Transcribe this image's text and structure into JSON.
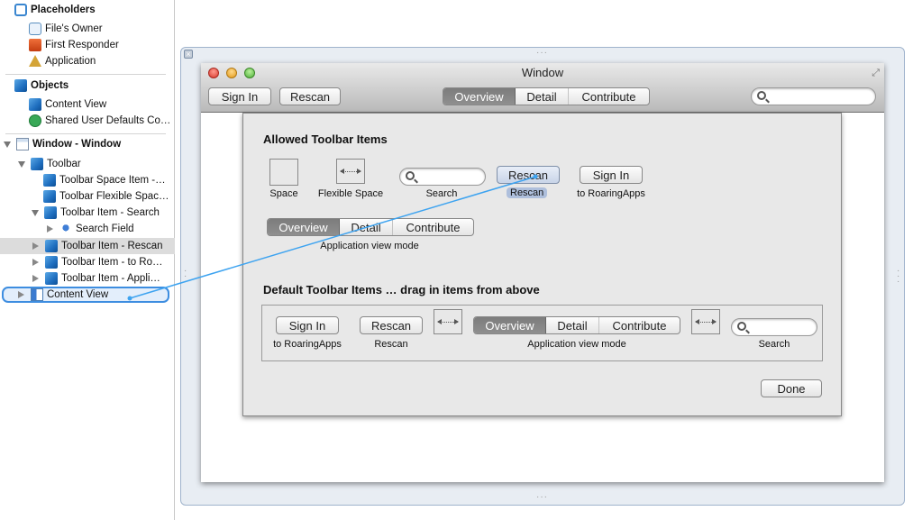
{
  "outline": {
    "placeholders": {
      "label": "Placeholders",
      "items": [
        {
          "label": "File's Owner",
          "icon": "files-owner-icon"
        },
        {
          "label": "First Responder",
          "icon": "first-responder-icon"
        },
        {
          "label": "Application",
          "icon": "application-icon"
        }
      ]
    },
    "objects": {
      "label": "Objects",
      "items": [
        {
          "label": "Content View",
          "icon": "view-cube-icon"
        },
        {
          "label": "Shared User Defaults Co…",
          "icon": "user-defaults-icon"
        }
      ]
    },
    "window": {
      "label": "Window - Window",
      "toolbar": "Toolbar",
      "toolbar_items": [
        "Toolbar Space Item -…",
        "Toolbar Flexible Spac…",
        "Toolbar Item - Search",
        "Search Field",
        "Toolbar Item - Rescan",
        "Toolbar Item - to Ro…",
        "Toolbar Item - Appli…"
      ],
      "content_view": "Content View",
      "selected": "Toolbar Item - Rescan"
    }
  },
  "window": {
    "title": "Window",
    "toolbar": {
      "sign_in": "Sign In",
      "rescan": "Rescan",
      "segments": [
        "Overview",
        "Detail",
        "Contribute"
      ],
      "selected_segment": "Overview",
      "search_placeholder": ""
    }
  },
  "sheet": {
    "allowed_title": "Allowed Toolbar Items",
    "allowed": {
      "space": "Space",
      "flexible_space": "Flexible Space",
      "search": "Search",
      "rescan_button": "Rescan",
      "rescan_label": "Rescan",
      "sign_in_button": "Sign In",
      "sign_in_label": "to RoaringApps",
      "segments": [
        "Overview",
        "Detail",
        "Contribute"
      ],
      "segments_label": "Application view mode"
    },
    "default_title": "Default Toolbar Items … drag in items from above",
    "default": {
      "sign_in_button": "Sign In",
      "sign_in_label": "to RoaringApps",
      "rescan_button": "Rescan",
      "rescan_label": "Rescan",
      "segments": [
        "Overview",
        "Detail",
        "Contribute"
      ],
      "segments_label": "Application view mode",
      "search_label": "Search"
    },
    "done": "Done"
  },
  "colors": {
    "connection_line": "#3da3f0",
    "selection_border": "#3d8de0",
    "segment_selected": "#858585"
  }
}
